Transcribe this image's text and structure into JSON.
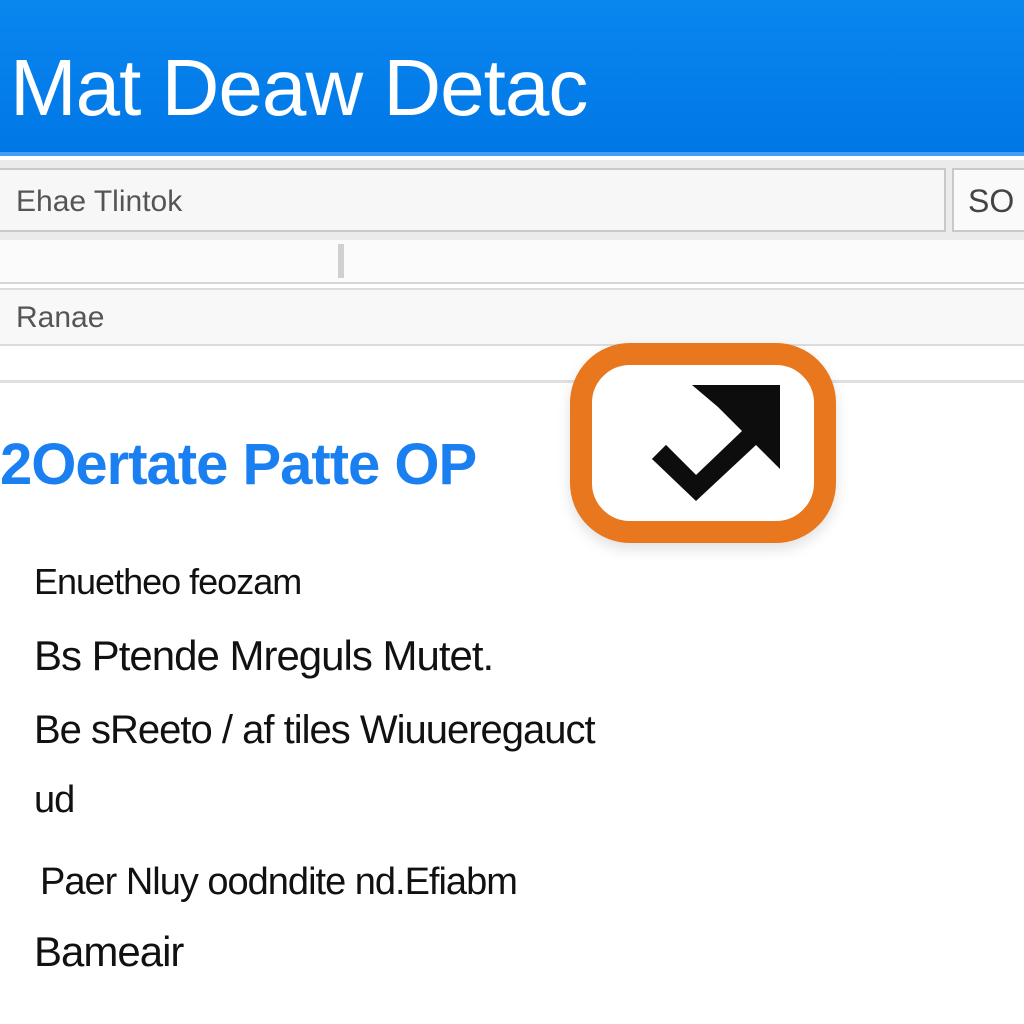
{
  "header": {
    "title": "Mat Deaw Detac"
  },
  "toolbar": {
    "field_text": "Ehae Tlintok",
    "button_label": "SO"
  },
  "field_row": {
    "text": "Ranae"
  },
  "content": {
    "title": "2Oertate Patte OP",
    "confirm_icon": "check-arrow-icon",
    "lines": [
      "Enuetheo feozam",
      "Bs Ptende Mreguls Mutet.",
      "Be sReeto / af tiles Wiuueregauct",
      "ud",
      "Paer Nluy oodndite nd.Efiabm",
      "Bameair"
    ]
  },
  "colors": {
    "header_bg": "#0a86ef",
    "title_blue": "#1a7ff0",
    "accent_orange": "#e8771e"
  }
}
